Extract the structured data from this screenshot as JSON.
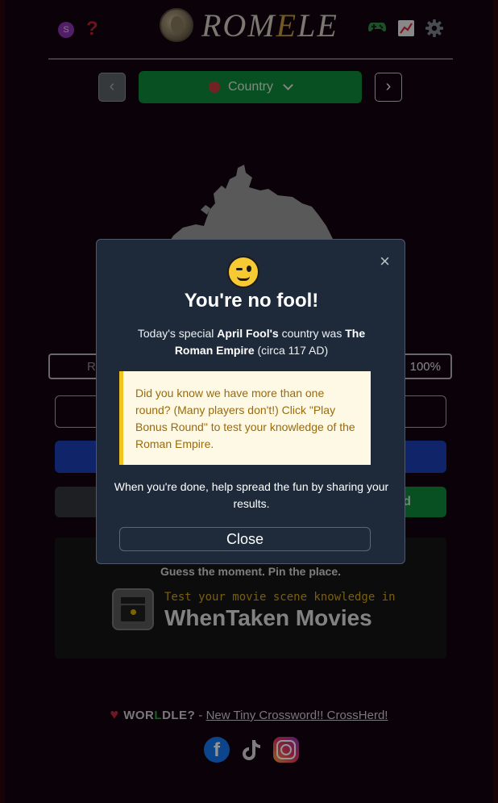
{
  "header": {
    "avatar_initial": "S",
    "help_glyph": "?",
    "logo_parts": [
      "ROM",
      "E",
      "LE"
    ],
    "icons": [
      "user-avatar",
      "help-icon",
      "coin-logo",
      "game-controller-icon",
      "stats-chart-icon",
      "gear-icon"
    ]
  },
  "round_nav": {
    "prev_glyph": "‹",
    "next_glyph": "›",
    "selected_round": "Country",
    "round_icon": "bug-icon"
  },
  "game": {
    "guess_row_prefix": "Ro",
    "proximity": "100%",
    "bonus_button_fragment": "d"
  },
  "ad": {
    "tagline": "Guess the moment. Pin the place.",
    "subtitle": "Test your movie scene knowledge in",
    "brand": "WhenTaken Movies"
  },
  "footer": {
    "worldle_parts": [
      "WOR",
      "L",
      "DLE?"
    ],
    "separator": " - ",
    "link_text": "New Tiny Crossword!! CrossHerd!",
    "social_icons": [
      "facebook-icon",
      "tiktok-icon",
      "instagram-icon"
    ],
    "facebook_glyph": "f"
  },
  "modal": {
    "title": "You're no fool!",
    "text_1": "Today's special ",
    "text_bold_1": "April Fool's",
    "text_2": " country was ",
    "text_bold_2": "The Roman Empire",
    "text_3": " (circa 117 AD)",
    "tip": "Did you know we have more than one round? (Many players don't!) Click \"Play Bonus Round\" to test your knowledge of the Roman Empire.",
    "footer_text": "When you're done, help spread the fun by sharing your results.",
    "close_button": "Close",
    "close_glyph": "×"
  },
  "colors": {
    "background": "#12040f",
    "accent_green": "#0e8a3a",
    "accent_blue": "#1c3fb6",
    "modal_bg": "#1e2a3a",
    "tip_bg": "#fef9e4",
    "tip_border": "#f0c320",
    "tip_text": "#9a6a0a"
  }
}
